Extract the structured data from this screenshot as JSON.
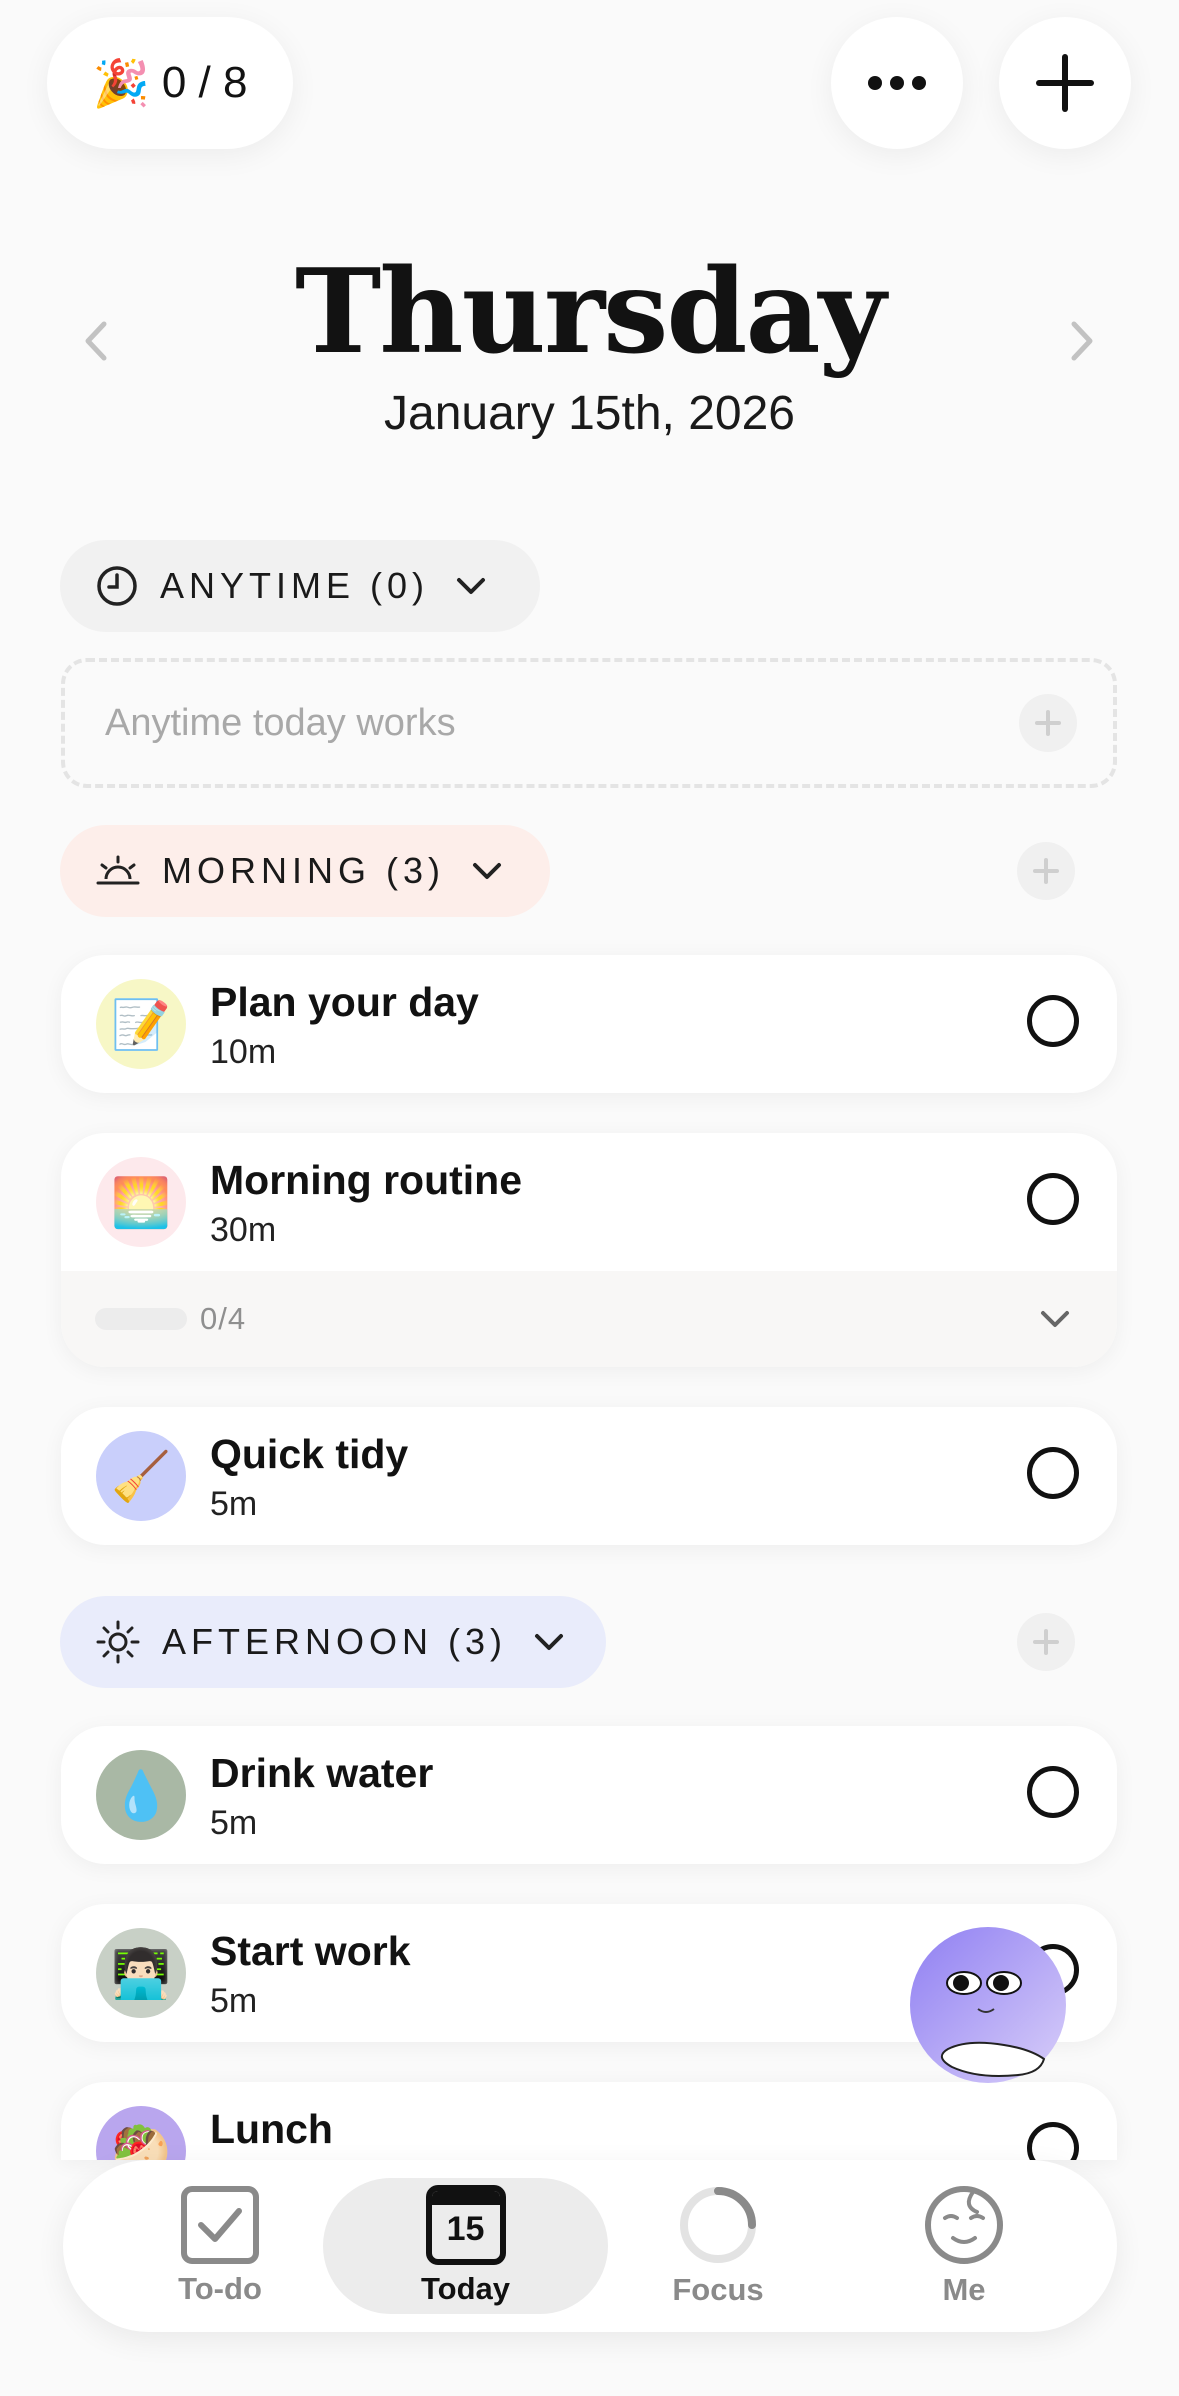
{
  "header": {
    "progress_text": "0 / 8",
    "progress": {
      "completed": 0,
      "total": 8
    }
  },
  "date": {
    "weekday": "Thursday",
    "full_date": "January 15th, 2026"
  },
  "sections": {
    "anytime": {
      "label": "ANYTIME (0)",
      "placeholder": "Anytime today works"
    },
    "morning": {
      "label": "MORNING (3)",
      "color": "#fdeeea",
      "tasks": [
        {
          "title": "Plan your day",
          "duration": "10m",
          "icon": "📝",
          "icon_name": "memo-icon",
          "bg": "#f7f7c6"
        },
        {
          "title": "Morning routine",
          "duration": "30m",
          "icon": "🌅",
          "icon_name": "sunrise-icon",
          "bg": "#fde9ec",
          "subtasks": "0/4"
        },
        {
          "title": "Quick tidy",
          "duration": "5m",
          "icon": "🧹",
          "icon_name": "broom-icon",
          "bg": "#c9cffb"
        }
      ]
    },
    "afternoon": {
      "label": "AFTERNOON (3)",
      "color": "#e9ecfb",
      "tasks": [
        {
          "title": "Drink water",
          "duration": "5m",
          "icon": "💧",
          "icon_name": "droplet-icon",
          "bg": "#a9b8a5"
        },
        {
          "title": "Start work",
          "duration": "5m",
          "icon": "👨🏻‍💻",
          "icon_name": "technologist-icon",
          "bg": "#c8d0c6"
        },
        {
          "title": "Lunch",
          "duration": "",
          "icon": "🥙",
          "icon_name": "food-icon",
          "bg": "#b9a6ee"
        }
      ]
    }
  },
  "tabs": [
    {
      "label": "To-do",
      "icon_name": "checkbox-icon",
      "active": false
    },
    {
      "label": "Today",
      "icon_name": "calendar-icon",
      "calendar_day": "15",
      "active": true
    },
    {
      "label": "Focus",
      "icon_name": "progress-ring-icon",
      "active": false
    },
    {
      "label": "Me",
      "icon_name": "face-icon",
      "active": false
    }
  ],
  "colors": {
    "background": "#fafafa",
    "morning_pill": "#fdeeea",
    "afternoon_pill": "#e9ecfb",
    "anytime_pill": "#f1f1f1",
    "assistant_orb": "#a99cf5"
  }
}
